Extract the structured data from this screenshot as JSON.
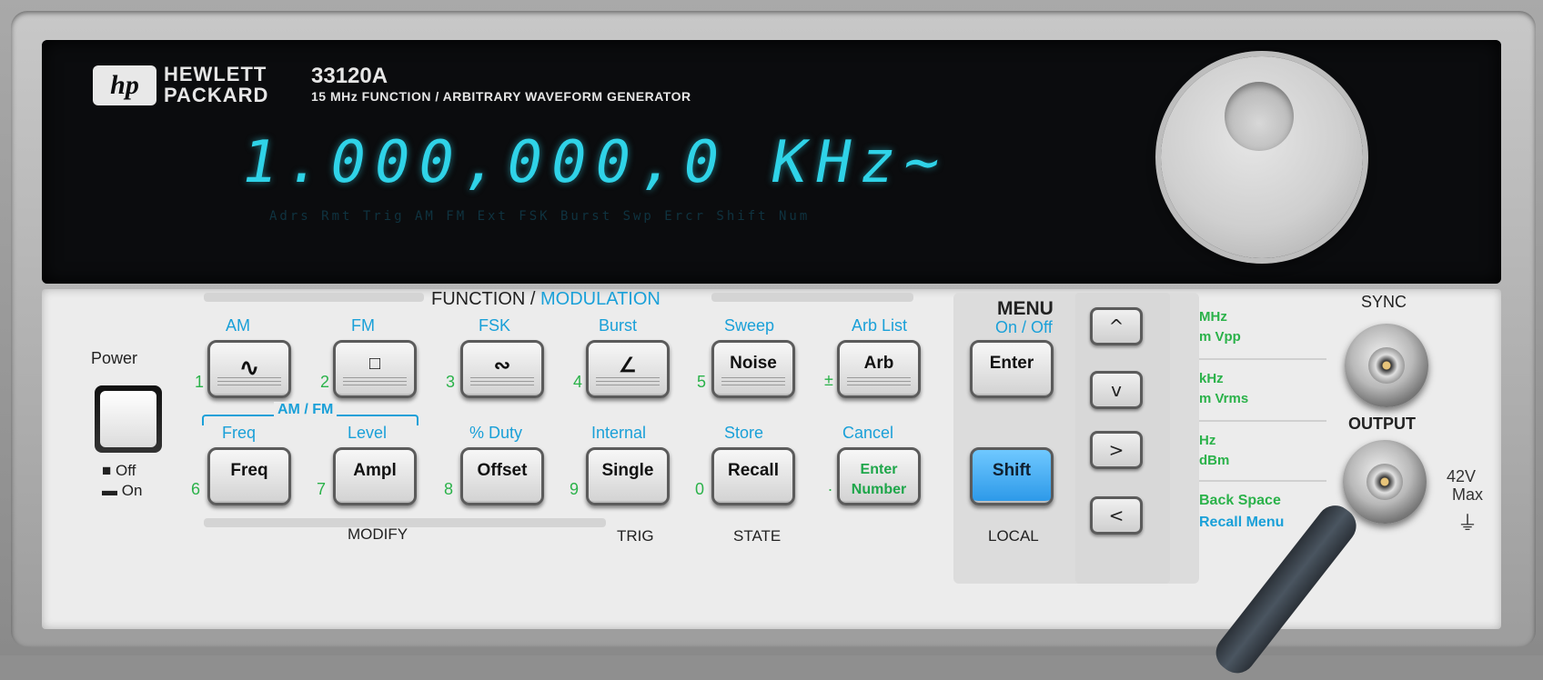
{
  "header": {
    "brand_logo": "hp",
    "brand_line1": "HEWLETT",
    "brand_line2": "PACKARD",
    "model": "33120A",
    "model_subtitle": "15 MHz  FUNCTION / ARBITRARY WAVEFORM GENERATOR"
  },
  "display": {
    "readout": "1.000,000,0  KHz~",
    "dim_annunciators": "Adrs  Rmt  Trig  AM  FM  Ext  FSK  Burst  Swp  Ercr  Shift  Num"
  },
  "function_group": {
    "title_function": "FUNCTION /",
    "title_modulation": "MODULATION",
    "top_labels": [
      "AM",
      "FM",
      "FSK",
      "Burst",
      "Sweep",
      "Arb List"
    ],
    "numbers_top": [
      "1",
      "2",
      "3",
      "4",
      "5",
      "±"
    ],
    "buttons_top": [
      "",
      "",
      "",
      "",
      "Noise",
      "Arb"
    ],
    "icons_top": [
      "sine-wave-icon",
      "square-wave-icon",
      "triangle-wave-icon",
      "ramp-wave-icon",
      "",
      ""
    ],
    "amfm_label": "AM / FM",
    "mid_labels": [
      "Freq",
      "Level",
      "% Duty",
      "Internal",
      "Store",
      "Cancel"
    ],
    "numbers_bottom": [
      "6",
      "7",
      "8",
      "9",
      "0",
      "."
    ],
    "buttons_bottom": [
      "Freq",
      "Ampl",
      "Offset",
      "Single",
      "Recall"
    ],
    "enter_number_line1": "Enter",
    "enter_number_line2": "Number",
    "group_modify": "MODIFY",
    "group_trig": "TRIG",
    "group_state": "STATE"
  },
  "power": {
    "label": "Power",
    "off_label": "Off",
    "on_label": "On"
  },
  "menu": {
    "title": "MENU",
    "subtitle": "On / Off",
    "enter": "Enter",
    "shift": "Shift",
    "local": "LOCAL"
  },
  "arrows": {
    "up": "^",
    "down": "v",
    "right": ">",
    "left": "<"
  },
  "units": {
    "u1a": "MHz",
    "u1b": "m Vpp",
    "u2a": "kHz",
    "u2b": "m Vrms",
    "u3a": "Hz",
    "u3b": "dBm",
    "u4a": "Back Space",
    "u4b": "Recall Menu"
  },
  "connectors": {
    "sync": "SYNC",
    "output": "OUTPUT",
    "max_line1": "42V",
    "max_line2": "Max"
  },
  "colors": {
    "vfd": "#2fd3e8",
    "accent_blue": "#1aa0d8",
    "accent_green": "#2bb24a",
    "shift_blue": "#2b98e8"
  }
}
